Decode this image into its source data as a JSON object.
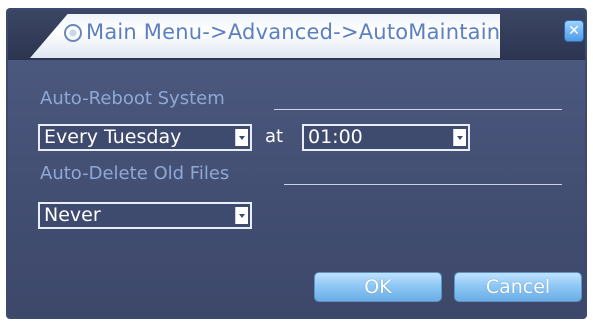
{
  "window": {
    "title": "Main Menu->Advanced->AutoMaintain",
    "close_icon": "close-x-icon",
    "accent_color": "#5b7fc0",
    "background_color": "#4a5679"
  },
  "auto_reboot": {
    "label": "Auto-Reboot System",
    "day_value": "Every Tuesday",
    "at_label": "at",
    "time_value": "01:00"
  },
  "auto_delete": {
    "label": "Auto-Delete Old Files",
    "value": "Never"
  },
  "buttons": {
    "ok_label": "OK",
    "cancel_label": "Cancel"
  }
}
